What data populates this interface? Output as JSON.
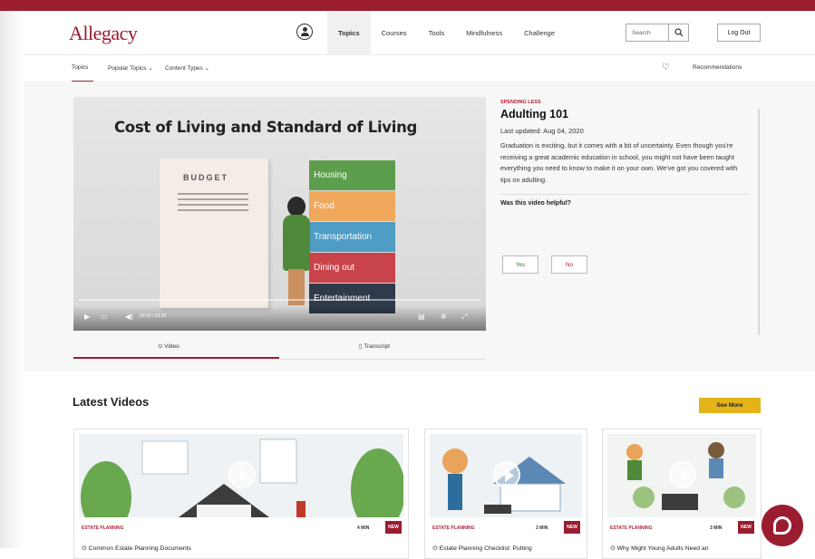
{
  "header": {
    "logo_text": "Allegacy",
    "nav": [
      "Topics",
      "Courses",
      "Tools",
      "Mindfulness",
      "Challenge"
    ],
    "search_placeholder": "Search",
    "logout_label": "Log Out"
  },
  "subnav": {
    "items": [
      "Topics",
      "Popular Topics ⌄",
      "Content Types ⌄"
    ],
    "recommendations": "Recommendations"
  },
  "video": {
    "title": "Cost of Living and Standard of Living",
    "budget_label": "BUDGET",
    "categories": [
      {
        "label": "Housing",
        "color": "#5c9e4d"
      },
      {
        "label": "Food",
        "color": "#f0a85c"
      },
      {
        "label": "Transportation",
        "color": "#4f9cc4"
      },
      {
        "label": "Dining out",
        "color": "#c8434a"
      },
      {
        "label": "Entertainment",
        "color": "#2f3a4a"
      }
    ],
    "time": "00:00 / 03:26",
    "tabs": [
      "Video",
      "Transcript"
    ]
  },
  "article": {
    "eyebrow": "SPENDING LESS",
    "title": "Adulting 101",
    "date": "Last updated: Aug 04, 2020",
    "description": "Graduation is exciting, but it comes with a bit of uncertainty. Even though you're receiving a great academic education in school, you might not have been taught everything you need to know to make it on your own. We've got you covered with tips on adulting.",
    "helpful_question": "Was this video helpful?",
    "yes_label": "Yes",
    "no_label": "No"
  },
  "latest": {
    "title": "Latest Videos",
    "see_more": "See More",
    "cards": [
      {
        "category": "ESTATE PLANNING",
        "length": "4 MIN",
        "badge": "NEW",
        "title": "⊙ Common Estate Planning Documents"
      },
      {
        "category": "ESTATE PLANNING",
        "length": "3 MIN",
        "badge": "NEW",
        "title": "⊙ Estate Planning Checklist: Putting"
      },
      {
        "category": "ESTATE PLANNING",
        "length": "3 MIN",
        "badge": "NEW",
        "title": "⊙ Why Might Young Adults Need an"
      }
    ]
  },
  "colors": {
    "brand": "#9b1c2e",
    "accent": "#e3b319"
  }
}
